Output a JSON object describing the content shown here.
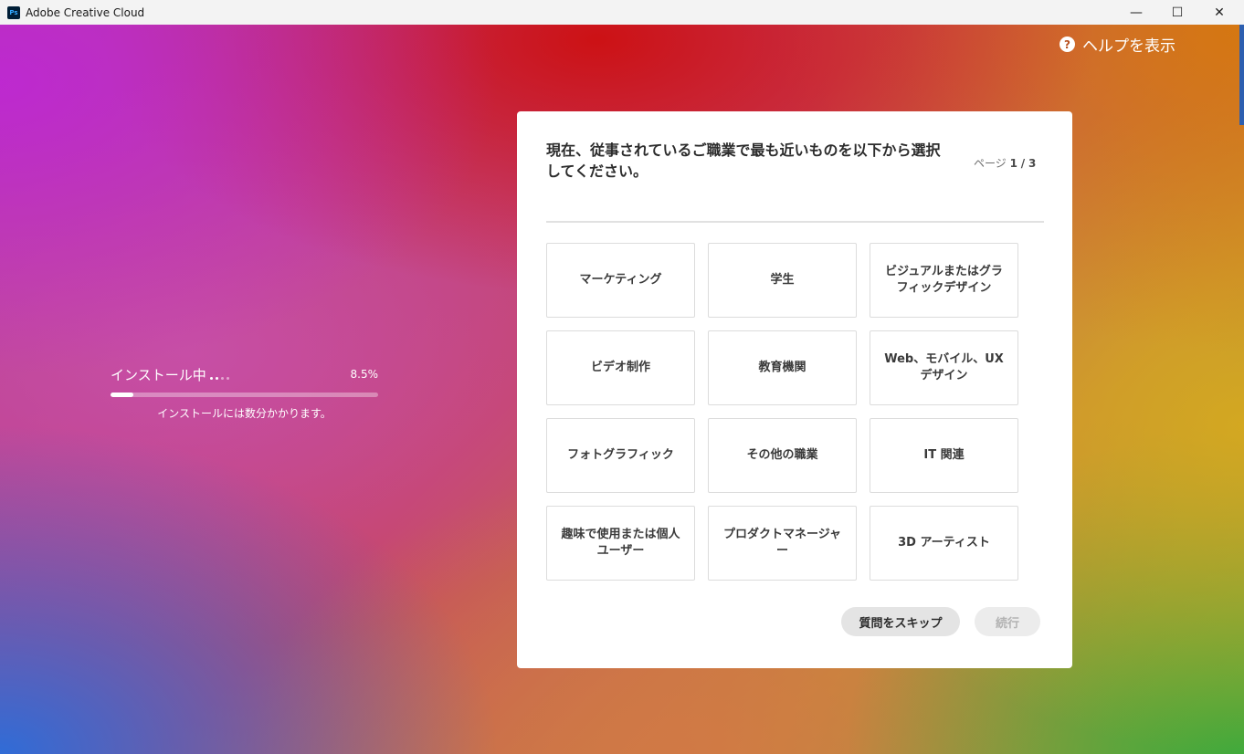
{
  "window": {
    "title": "Adobe Creative Cloud",
    "app_icon_text": "Ps",
    "minimize": "—",
    "maximize": "☐",
    "close": "✕"
  },
  "help": {
    "icon": "?",
    "label": "ヘルプを表示"
  },
  "install": {
    "label": "インストール中",
    "percent_text": "8.5%",
    "progress": 0.085,
    "note": "インストールには数分かかります。"
  },
  "survey": {
    "question": "現在、従事されているご職業で最も近いものを以下から選択してください。",
    "page_prefix": "ページ",
    "page_current": "1",
    "page_sep": "/",
    "page_total": "3",
    "options": [
      "マーケティング",
      "学生",
      "ビジュアルまたはグラフィックデザイン",
      "ビデオ制作",
      "教育機関",
      "Web、モバイル、UX デザイン",
      "フォトグラフィック",
      "その他の職業",
      "IT 関連",
      "趣味で使用または個人ユーザー",
      "プロダクトマネージャー",
      "3D アーティスト"
    ],
    "skip_label": "質問をスキップ",
    "next_label": "続行"
  },
  "colors": {
    "card_bg": "#ffffff",
    "disabled_text": "#b3b3b3"
  }
}
